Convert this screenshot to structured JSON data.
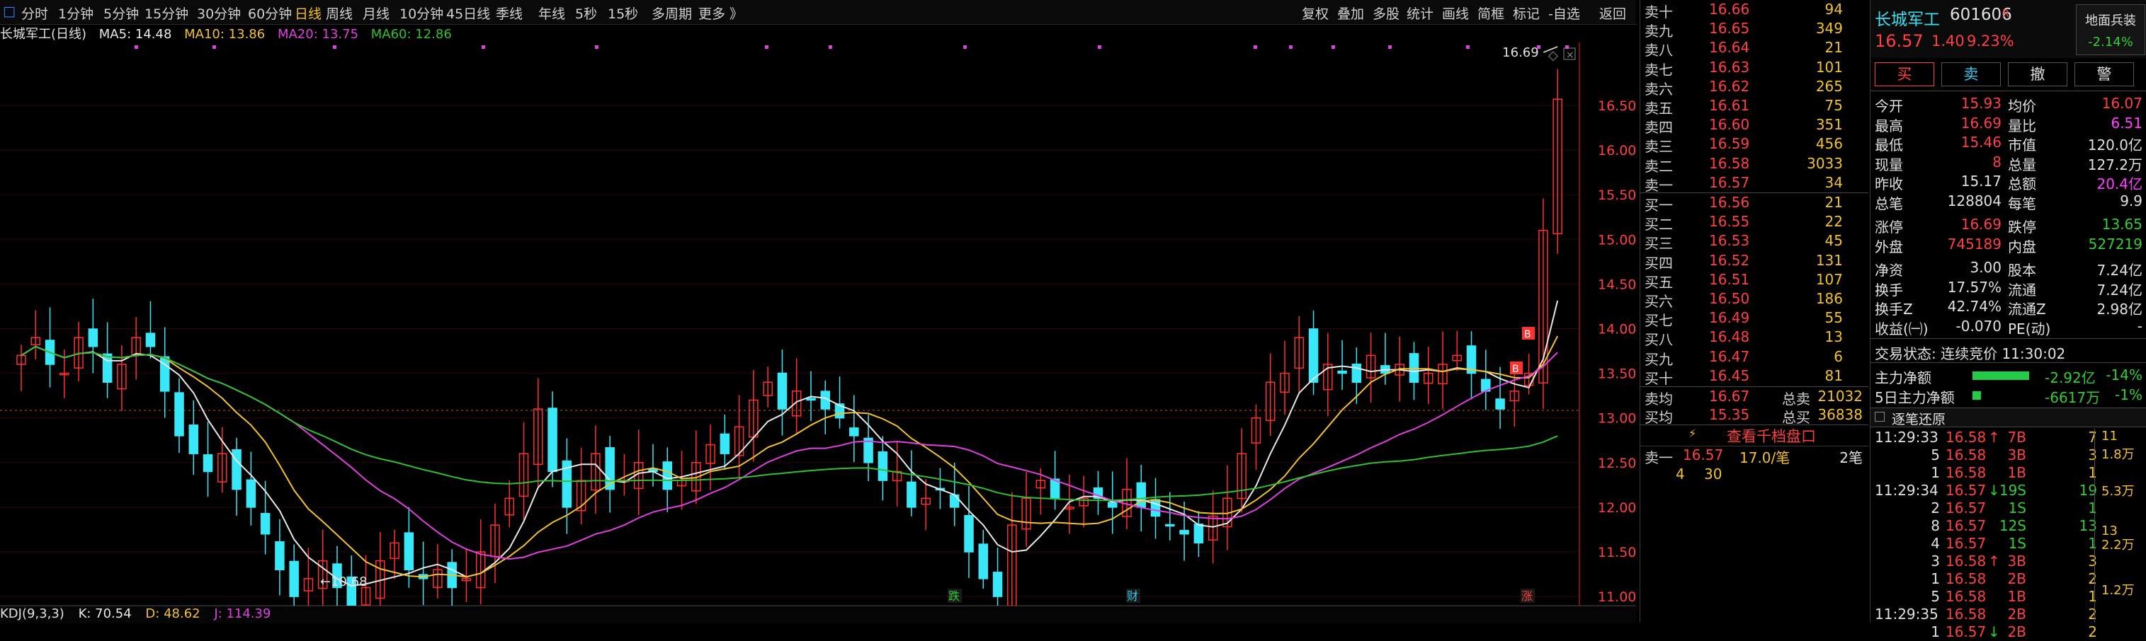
{
  "periods": [
    "分时",
    "1分钟",
    "5分钟",
    "15分钟",
    "30分钟",
    "60分钟",
    "日线",
    "周线",
    "月线",
    "10分钟",
    "45日线",
    "季线",
    "年线",
    "5秒",
    "15秒",
    "多周期",
    "更多 》"
  ],
  "active_period": "日线",
  "toolbar": [
    "复权",
    "叠加",
    "多股",
    "统计",
    "画线",
    "简框",
    "标记",
    "-自选",
    "返回"
  ],
  "chart": {
    "title": "长城军工(日线)",
    "ma5": "MA5: 14.48",
    "ma10": "MA10: 13.86",
    "ma20": "MA20: 13.75",
    "ma60": "MA60: 12.86",
    "ma_colors": {
      "ma5": "#e8e8e8",
      "ma10": "#f2c12e",
      "ma20": "#e040e0",
      "ma60": "#30c030"
    },
    "y_ticks": [
      "16.50",
      "16.00",
      "15.50",
      "15.00",
      "14.50",
      "14.00",
      "13.50",
      "13.00",
      "12.50",
      "12.00",
      "11.50",
      "11.00"
    ],
    "high_label": "16.69",
    "low_label": "10.68",
    "markers": [
      {
        "text": "跌",
        "color": "#33cc33"
      },
      {
        "text": "财",
        "color": "#38c8f0"
      },
      {
        "text": "涨",
        "color": "#ff4040"
      }
    ],
    "b_marker": "B"
  },
  "kdj": {
    "name": "KDJ(9,3,3)",
    "k": "K: 70.54",
    "d": "D: 48.62",
    "j": "J: 114.39"
  },
  "asks": [
    {
      "l": "卖十",
      "p": "16.66",
      "v": "94"
    },
    {
      "l": "卖九",
      "p": "16.65",
      "v": "349"
    },
    {
      "l": "卖八",
      "p": "16.64",
      "v": "21"
    },
    {
      "l": "卖七",
      "p": "16.63",
      "v": "101"
    },
    {
      "l": "卖六",
      "p": "16.62",
      "v": "265"
    },
    {
      "l": "卖五",
      "p": "16.61",
      "v": "75"
    },
    {
      "l": "卖四",
      "p": "16.60",
      "v": "351"
    },
    {
      "l": "卖三",
      "p": "16.59",
      "v": "456"
    },
    {
      "l": "卖二",
      "p": "16.58",
      "v": "3033"
    },
    {
      "l": "卖一",
      "p": "16.57",
      "v": "34"
    }
  ],
  "bids": [
    {
      "l": "买一",
      "p": "16.56",
      "v": "21"
    },
    {
      "l": "买二",
      "p": "16.55",
      "v": "22"
    },
    {
      "l": "买三",
      "p": "16.53",
      "v": "45"
    },
    {
      "l": "买四",
      "p": "16.52",
      "v": "131"
    },
    {
      "l": "买五",
      "p": "16.51",
      "v": "107"
    },
    {
      "l": "买六",
      "p": "16.50",
      "v": "186"
    },
    {
      "l": "买七",
      "p": "16.49",
      "v": "55"
    },
    {
      "l": "买八",
      "p": "16.48",
      "v": "13"
    },
    {
      "l": "买九",
      "p": "16.47",
      "v": "6"
    },
    {
      "l": "买十",
      "p": "16.45",
      "v": "81"
    }
  ],
  "book_summary": [
    {
      "l": "卖均",
      "p": "16.67",
      "k": "总卖",
      "v": "21032"
    },
    {
      "l": "买均",
      "p": "15.35",
      "k": "总买",
      "v": "36838"
    }
  ],
  "view_1000": "查看千档盘口",
  "last_trade": {
    "l": "卖一",
    "p": "16.57",
    "size": "17.0/笔",
    "cnt": "2笔",
    "a": "4",
    "b": "30"
  },
  "stock": {
    "name": "长城军工",
    "code": "601606",
    "tag": "R",
    "sector": "地面兵装",
    "sector_chg": "-2.14%",
    "price": "16.57",
    "chg": "1.40",
    "pct": "9.23%"
  },
  "actions": [
    "买",
    "卖",
    "撤",
    "警"
  ],
  "stats_left": [
    {
      "k": "今开",
      "v": "15.93",
      "c": "red"
    },
    {
      "k": "最高",
      "v": "16.69",
      "c": "red"
    },
    {
      "k": "最低",
      "v": "15.46",
      "c": "red"
    },
    {
      "k": "现量",
      "v": "8",
      "c": "red"
    },
    {
      "k": "昨收",
      "v": "15.17",
      "c": "white"
    },
    {
      "k": "总笔",
      "v": "128804",
      "c": "white"
    },
    {
      "k": "涨停",
      "v": "16.69",
      "c": "red"
    },
    {
      "k": "外盘",
      "v": "745189",
      "c": "red"
    },
    {
      "k": "净资",
      "v": "3.00",
      "c": "white"
    },
    {
      "k": "换手",
      "v": "17.57%",
      "c": "white"
    },
    {
      "k": "换手Z",
      "v": "42.74%",
      "c": "white"
    },
    {
      "k": "收益(㈠)",
      "v": "-0.070",
      "c": "white"
    }
  ],
  "stats_right": [
    {
      "k": "均价",
      "v": "16.07",
      "c": "red"
    },
    {
      "k": "量比",
      "v": "6.51",
      "c": "magenta"
    },
    {
      "k": "市值",
      "v": "120.0亿",
      "c": "white"
    },
    {
      "k": "总量",
      "v": "127.2万",
      "c": "white"
    },
    {
      "k": "总额",
      "v": "20.4亿",
      "c": "magenta"
    },
    {
      "k": "每笔",
      "v": "9.9",
      "c": "white"
    },
    {
      "k": "跌停",
      "v": "13.65",
      "c": "green"
    },
    {
      "k": "内盘",
      "v": "527219",
      "c": "green"
    },
    {
      "k": "股本",
      "v": "7.24亿",
      "c": "white"
    },
    {
      "k": "流通",
      "v": "7.24亿",
      "c": "white"
    },
    {
      "k": "流通Z",
      "v": "2.98亿",
      "c": "white"
    },
    {
      "k": "PE(动)",
      "v": "-",
      "c": "white"
    }
  ],
  "trade_status": "交易状态: 连续竞价 11:30:02",
  "flow": [
    {
      "k": "主力净额",
      "v": "-2.92亿",
      "p": "-14%"
    },
    {
      "k": "5日主力净额",
      "v": "-6617万",
      "p": "-1%"
    }
  ],
  "ticks_title": "逐笔还原",
  "ticks": [
    {
      "t": "11:29:33",
      "p": "16.58",
      "a": "↑",
      "n": "7B",
      "c": "7"
    },
    {
      "t": "5",
      "p": "16.58",
      "a": "",
      "n": "3B",
      "c": "3"
    },
    {
      "t": "1",
      "p": "16.58",
      "a": "",
      "n": "1B",
      "c": "1"
    },
    {
      "t": "11:29:34",
      "p": "16.57",
      "a": "↓",
      "n": "19S",
      "c": "19"
    },
    {
      "t": "2",
      "p": "16.57",
      "a": "",
      "n": "1S",
      "c": "1"
    },
    {
      "t": "8",
      "p": "16.57",
      "a": "",
      "n": "12S",
      "c": "13"
    },
    {
      "t": "4",
      "p": "16.57",
      "a": "",
      "n": "1S",
      "c": "1"
    },
    {
      "t": "3",
      "p": "16.58",
      "a": "↑",
      "n": "3B",
      "c": "3"
    },
    {
      "t": "1",
      "p": "16.58",
      "a": "",
      "n": "2B",
      "c": "2"
    },
    {
      "t": "5",
      "p": "16.58",
      "a": "",
      "n": "1B",
      "c": "1"
    },
    {
      "t": "11:29:35",
      "p": "16.58",
      "a": "",
      "n": "2B",
      "c": "2"
    },
    {
      "t": "1",
      "p": "16.57",
      "a": "↓",
      "n": "2B",
      "c": "2"
    }
  ],
  "tick_side": [
    "11",
    "1.8万",
    "5.3万",
    "13",
    "2.2万",
    "1.2万"
  ]
}
